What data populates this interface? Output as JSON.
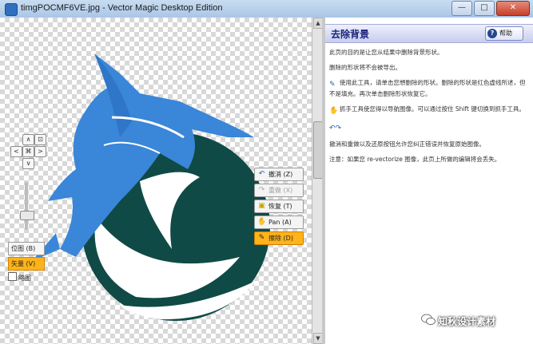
{
  "window": {
    "title": "timgPOCMF6VE.jpg - Vector Magic Desktop Edition",
    "controls": {
      "minimize": "—",
      "maximize": "□",
      "close": "✕"
    }
  },
  "navigation": {
    "up": "∧",
    "down": "∨",
    "left": "<",
    "right": ">",
    "center": "⌘",
    "fit": "⊡",
    "zoom_level": 0.35
  },
  "view": {
    "bitmap_label": "位图 (B)",
    "vector_label": "矢量 (V)",
    "overlay_label": "略图"
  },
  "tools": {
    "undo": "撤消 (Z)",
    "redo": "重做 (X)",
    "restore": "恢复 (T)",
    "pan": "Pan (A)",
    "erase": "擦除 (D)"
  },
  "help": {
    "title": "去除背景",
    "help_button": "帮助",
    "p1": "此页的目的是让您从结果中删除背景形状。",
    "p2": "删除的形状将不会被导出。",
    "p3": "使用此工具，请单击您想删除的形状。删除的形状是红色虚线所述，但不是填充。再次单击删除形状恢复它。",
    "p4": "抓手工具使您得以导航图像。可以通过按住 Shift 键切换到抓手工具。",
    "p5": "撤消和重做以及还原按钮允许您纠正错误并恢复原始图像。",
    "p6": "注意：如果您 re-vectorize 图像，此页上所做的编辑将会丢失。"
  },
  "watermark": {
    "text": "知秋设计素材"
  },
  "colors": {
    "fish_blue": "#3a86d8",
    "circle_teal": "#0f4a46",
    "accent_orange": "#ffb31a"
  }
}
